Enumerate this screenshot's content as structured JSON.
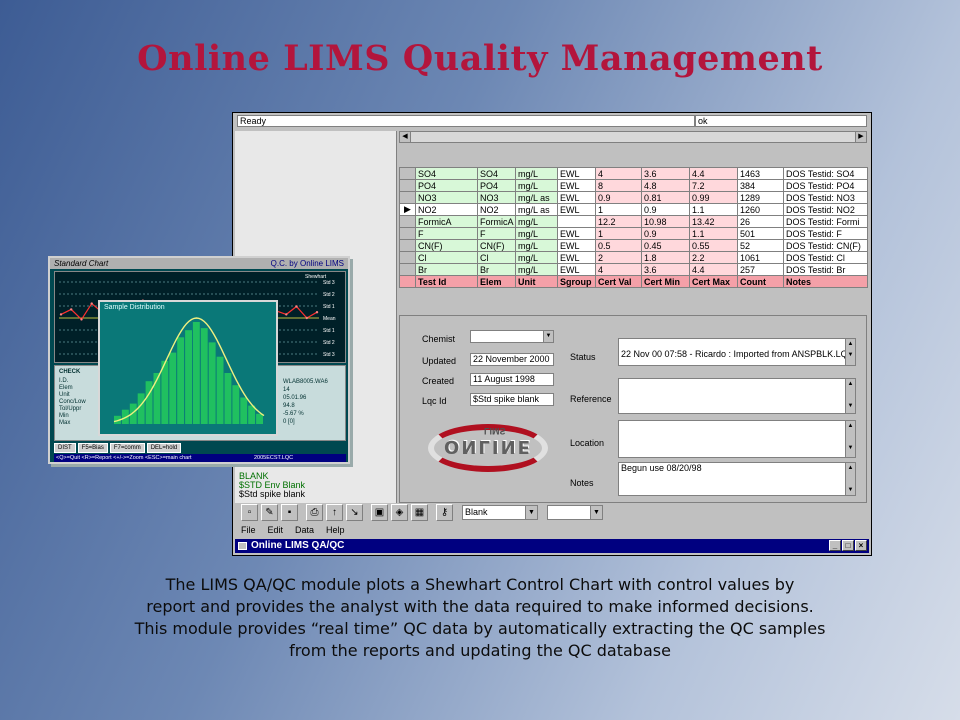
{
  "slide": {
    "title": "Online LIMS Quality Management",
    "caption_lines": [
      "The LIMS QA/QC module plots a Shewhart Control Chart with control values by",
      "report and provides the analyst with the data required to make informed  decisions.",
      "This module provides “real time” QC data by automatically extracting the QC samples",
      "from the reports and updating the QC database"
    ]
  },
  "window": {
    "title": "Online LIMS QA/QC",
    "buttons": [
      "_",
      "□",
      "×"
    ],
    "menu": [
      "File",
      "Edit",
      "Data",
      "Help"
    ],
    "toolbar_select_1": "Blank",
    "status_left": "Ready",
    "status_right": "ok",
    "left_list": [
      "BLANK",
      "$STD Env Blank",
      "$Std spike blank"
    ]
  },
  "grid": {
    "columns": [
      "Test Id",
      "Elem",
      "Unit",
      "Sgroup",
      "Cert Val",
      "Cert Min",
      "Cert Max",
      "Count",
      "Notes"
    ],
    "rows": [
      {
        "id": "Br",
        "elem": "Br",
        "unit": "mg/L",
        "sgroup": "EWL",
        "cert": "4",
        "min": "3.6",
        "max": "4.4",
        "count": "257",
        "notes": "DOS Testid: Br"
      },
      {
        "id": "Cl",
        "elem": "Cl",
        "unit": "mg/L",
        "sgroup": "EWL",
        "cert": "2",
        "min": "1.8",
        "max": "2.2",
        "count": "1061",
        "notes": "DOS Testid: Cl"
      },
      {
        "id": "CN(F)",
        "elem": "CN(F)",
        "unit": "mg/L",
        "sgroup": "EWL",
        "cert": "0.5",
        "min": "0.45",
        "max": "0.55",
        "count": "52",
        "notes": "DOS Testid: CN(F)"
      },
      {
        "id": "F",
        "elem": "F",
        "unit": "mg/L",
        "sgroup": "EWL",
        "cert": "1",
        "min": "0.9",
        "max": "1.1",
        "count": "501",
        "notes": "DOS Testid: F"
      },
      {
        "id": "FormicA",
        "elem": "FormicA",
        "unit": "mg/L",
        "sgroup": "",
        "cert": "12.2",
        "min": "10.98",
        "max": "13.42",
        "count": "26",
        "notes": "DOS Testid: Formi"
      },
      {
        "id": "NO2",
        "elem": "NO2",
        "unit": "mg/L as",
        "sgroup": "EWL",
        "cert": "1",
        "min": "0.9",
        "max": "1.1",
        "count": "1260",
        "notes": "DOS Testid: NO2"
      },
      {
        "id": "NO3",
        "elem": "NO3",
        "unit": "mg/L as",
        "sgroup": "EWL",
        "cert": "0.9",
        "min": "0.81",
        "max": "0.99",
        "count": "1289",
        "notes": "DOS Testid: NO3"
      },
      {
        "id": "PO4",
        "elem": "PO4",
        "unit": "mg/L",
        "sgroup": "EWL",
        "cert": "8",
        "min": "4.8",
        "max": "7.2",
        "count": "384",
        "notes": "DOS Testid: PO4"
      },
      {
        "id": "SO4",
        "elem": "SO4",
        "unit": "mg/L",
        "sgroup": "EWL",
        "cert": "4",
        "min": "3.6",
        "max": "4.4",
        "count": "1463",
        "notes": "DOS Testid: SO4"
      }
    ]
  },
  "form": {
    "chemist_label": "Chemist",
    "updated_label": "Updated",
    "updated_value": "22 November 2000",
    "created_label": "Created",
    "created_value": "11 August 1998",
    "lqc_label": "Lqc Id",
    "lqc_value": "$Std spike blank",
    "status_label": "Status",
    "status_value": "22 Nov 00 07:58 - Ricardo : Imported from ANSPBLK.LQC",
    "reference_label": "Reference",
    "location_label": "Location",
    "notes_label": "Notes",
    "notes_value": "Begun use 08/20/98",
    "logo_text": "ONLINE",
    "logo_sub": "LIMS"
  },
  "chart": {
    "title": "Standard Chart",
    "brand": "Q.C. by Online LIMS",
    "popup_title": "Sample Distribution",
    "shewhart_label": "Shewhart",
    "levels": [
      "Std 3",
      "Std 2",
      "Std 1",
      "Mean",
      "Std 1",
      "Std 2",
      "Std 3"
    ],
    "check_label": "CHECK",
    "fields": [
      "I.D.",
      "Elem",
      "Unit",
      "Conc/Low",
      "Tol/Uppr",
      "Min",
      "Max"
    ],
    "info_values": [
      "WLAB8005.WA6",
      "14",
      "05.01.96",
      "94.8",
      "-5.67 %",
      "0 [0]"
    ],
    "buttons": [
      "DIST",
      "F5=Bias",
      "F7=comm",
      "DEL=hold"
    ],
    "footer": "<Q>=Quit <R>=Report <+/->=Zoom <ESC>=main chart",
    "footer_right": "2005ECST.LQC",
    "hist_heights": [
      0.08,
      0.14,
      0.2,
      0.3,
      0.42,
      0.5,
      0.62,
      0.7,
      0.85,
      0.92,
      1.0,
      0.94,
      0.8,
      0.66,
      0.5,
      0.38,
      0.26,
      0.18,
      0.1
    ],
    "series": [
      0.55,
      0.62,
      0.48,
      0.7,
      0.58,
      0.4,
      0.66,
      0.52,
      0.74,
      0.6,
      0.45,
      0.57,
      0.68,
      0.5,
      0.62,
      0.44,
      0.59,
      0.71,
      0.53,
      0.63,
      0.47,
      0.6,
      0.55,
      0.66,
      0.5,
      0.58
    ]
  }
}
